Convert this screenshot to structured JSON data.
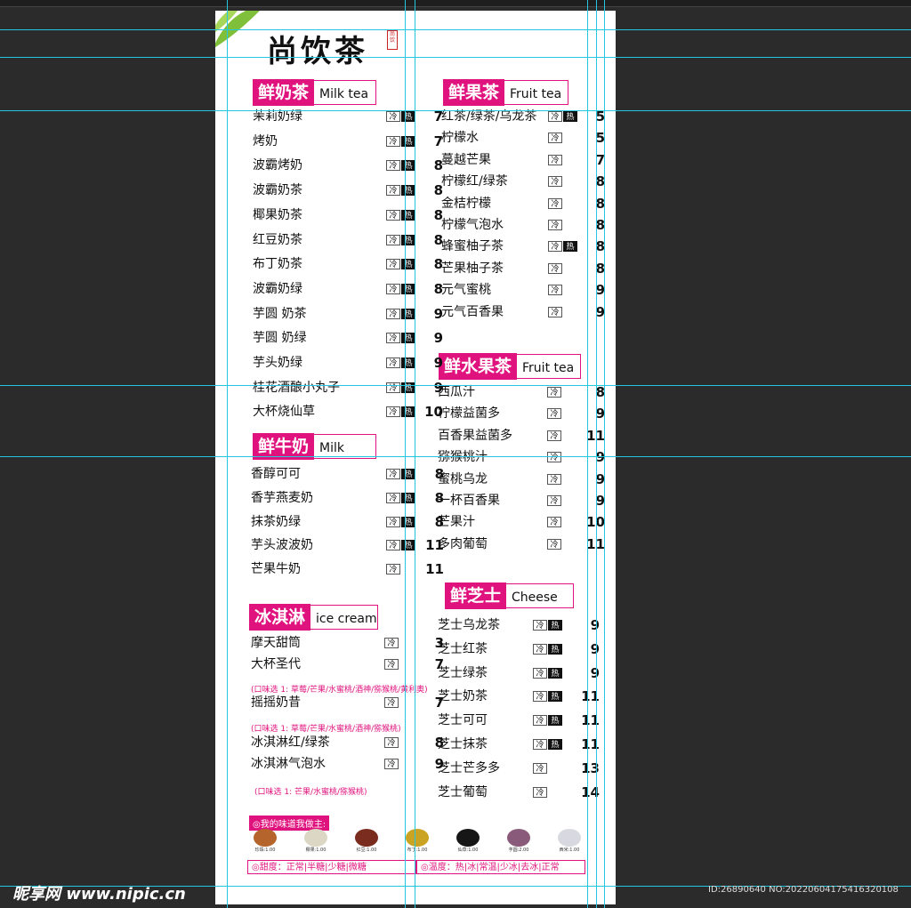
{
  "brand": "尚饮茶",
  "seal": "尚饮",
  "tag_cold": "冷",
  "tag_hot": "热",
  "sections": [
    {
      "cn": "鲜奶茶",
      "en": "Milk tea"
    },
    {
      "cn": "鲜牛奶",
      "en": "Milk"
    },
    {
      "cn": "冰淇淋",
      "en": "ice cream"
    },
    {
      "cn": "鲜果茶",
      "en": "Fruit tea"
    },
    {
      "cn": "鲜水果茶",
      "en": "Fruit tea"
    },
    {
      "cn": "鲜芝士",
      "en": "Cheese"
    }
  ],
  "milk_tea": [
    {
      "name": "茉莉奶绿",
      "price": "7",
      "hot": true
    },
    {
      "name": "烤奶",
      "price": "7",
      "hot": true
    },
    {
      "name": "波霸烤奶",
      "price": "8",
      "hot": true
    },
    {
      "name": "波霸奶茶",
      "price": "8",
      "hot": true
    },
    {
      "name": "椰果奶茶",
      "price": "8",
      "hot": true
    },
    {
      "name": "红豆奶茶",
      "price": "8",
      "hot": true
    },
    {
      "name": "布丁奶茶",
      "price": "8",
      "hot": true
    },
    {
      "name": "波霸奶绿",
      "price": "8",
      "hot": true
    },
    {
      "name": "芋圆 奶茶",
      "price": "9",
      "hot": true
    },
    {
      "name": "芋圆 奶绿",
      "price": "9",
      "hot": true
    },
    {
      "name": "芋头奶绿",
      "price": "9",
      "hot": true
    },
    {
      "name": "桂花酒酿小丸子",
      "price": "9",
      "hot": true
    },
    {
      "name": "大杯烧仙草",
      "price": "10",
      "hot": true
    }
  ],
  "milk": [
    {
      "name": "香醇可可",
      "price": "8",
      "hot": true
    },
    {
      "name": "香芋燕麦奶",
      "price": "8",
      "hot": true
    },
    {
      "name": "抹茶奶绿",
      "price": "8",
      "hot": true
    },
    {
      "name": "芋头波波奶",
      "price": "11",
      "hot": true
    },
    {
      "name": "芒果牛奶",
      "price": "11",
      "hot": false
    }
  ],
  "ice_cream": [
    {
      "name": "摩天甜筒",
      "price": "3",
      "hot": false
    },
    {
      "name": "大杯圣代",
      "price": "7",
      "hot": false
    },
    {
      "name": "摇摇奶昔",
      "price": "7",
      "hot": false
    },
    {
      "name": "冰淇淋红/绿茶",
      "price": "8",
      "hot": false
    },
    {
      "name": "冰淇淋气泡水",
      "price": "9",
      "hot": false
    }
  ],
  "ice_notes": [
    "(口味选 1: 草莓/芒果/水蜜桃/酒神/猕猴桃/黄利奥)",
    "(口味选 1: 草莓/芒果/水蜜桃/酒神/猕猴桃)",
    "(口味选 1: 芒果/水蜜桃/猕猴桃)"
  ],
  "fruit_tea": [
    {
      "name": "红茶/绿茶/乌龙茶",
      "price": "5",
      "hot": true
    },
    {
      "name": "柠檬水",
      "price": "5",
      "hot": false
    },
    {
      "name": "蔓越芒果",
      "price": "7",
      "hot": false
    },
    {
      "name": "柠檬红/绿茶",
      "price": "8",
      "hot": false
    },
    {
      "name": "金桔柠檬",
      "price": "8",
      "hot": false
    },
    {
      "name": "柠檬气泡水",
      "price": "8",
      "hot": false
    },
    {
      "name": "蜂蜜柚子茶",
      "price": "8",
      "hot": true
    },
    {
      "name": "芒果柚子茶",
      "price": "8",
      "hot": false
    },
    {
      "name": "元气蜜桃",
      "price": "9",
      "hot": false
    },
    {
      "name": "元气百香果",
      "price": "9",
      "hot": false
    }
  ],
  "fresh_fruit": [
    {
      "name": "西瓜汁",
      "price": "8",
      "hot": false
    },
    {
      "name": "柠檬益菌多",
      "price": "9",
      "hot": false
    },
    {
      "name": "百香果益菌多",
      "price": "11",
      "hot": false
    },
    {
      "name": "猕猴桃汁",
      "price": "9",
      "hot": false
    },
    {
      "name": "蜜桃乌龙",
      "price": "9",
      "hot": false
    },
    {
      "name": "一杯百香果",
      "price": "9",
      "hot": false
    },
    {
      "name": "芒果汁",
      "price": "10",
      "hot": false
    },
    {
      "name": "多肉葡萄",
      "price": "11",
      "hot": false
    }
  ],
  "cheese": [
    {
      "name": "芝士乌龙茶",
      "price": "9",
      "hot": true
    },
    {
      "name": "芝士红茶",
      "price": "9",
      "hot": true
    },
    {
      "name": "芝士绿茶",
      "price": "9",
      "hot": true
    },
    {
      "name": "芝士奶茶",
      "price": "11",
      "hot": true
    },
    {
      "name": "芝士可可",
      "price": "11",
      "hot": true
    },
    {
      "name": "芝士抹茶",
      "price": "11",
      "hot": true
    },
    {
      "name": "芝士芒多多",
      "price": "13",
      "hot": false
    },
    {
      "name": "芝士葡萄",
      "price": "14",
      "hot": false
    }
  ],
  "toppings_label": "◎我的味道我做主:",
  "toppings": [
    {
      "label": "珍珠:1.00",
      "color": "#b5652b"
    },
    {
      "label": "椰果:1.00",
      "color": "#dcd7c4"
    },
    {
      "label": "红豆:1.00",
      "color": "#7a2c1e"
    },
    {
      "label": "布丁:1.00",
      "color": "#c9a321"
    },
    {
      "label": "仙草:1.00",
      "color": "#161616"
    },
    {
      "label": "芋圆:2.00",
      "color": "#8a5a7a"
    },
    {
      "label": "西米:1.00",
      "color": "#d8d8e0"
    }
  ],
  "sweetness": "◎甜度：正常|半糖|少糖|微糖",
  "temperature": "◎温度：热|冰|常温|少冰|去冰|正常",
  "watermark_left": "昵享网 www.nipic.cn",
  "watermark_right": "ID:26890640 NO:20220604175416320108",
  "colors": {
    "accent": "#e0137e",
    "guide": "#22c7e0",
    "canvas": "#2b2b2b"
  }
}
